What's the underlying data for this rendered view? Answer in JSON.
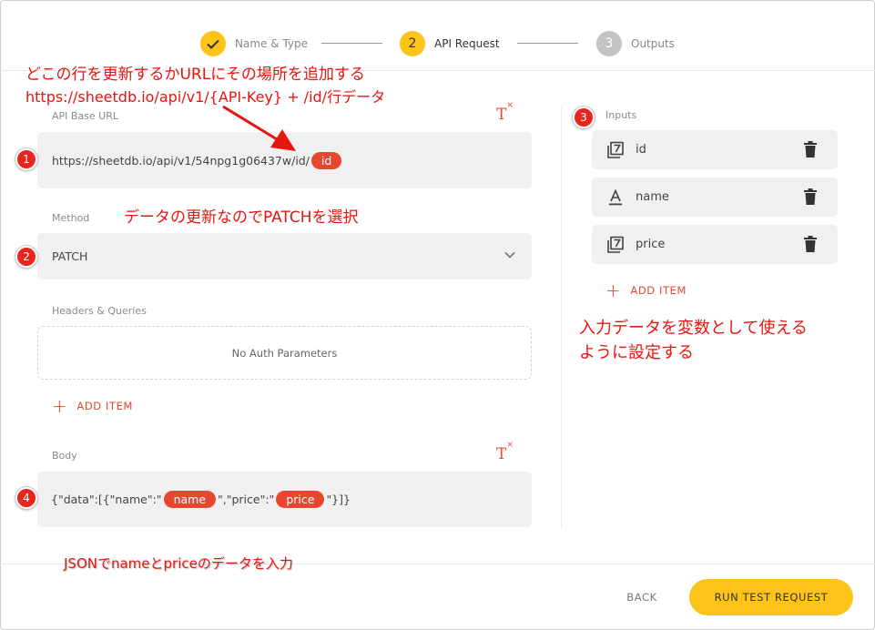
{
  "stepper": {
    "steps": [
      {
        "number": "✓",
        "label": "Name & Type",
        "state": "done"
      },
      {
        "number": "2",
        "label": "API Request",
        "state": "active"
      },
      {
        "number": "3",
        "label": "Outputs",
        "state": "pending"
      }
    ]
  },
  "form": {
    "api_base_url_label": "API Base URL",
    "api_base_url_value": "https://sheetdb.io/api/v1/54npg1g06437w/id/",
    "api_base_url_variable": "id",
    "method_label": "Method",
    "method_value": "PATCH",
    "headers_label": "Headers & Queries",
    "headers_empty": "No Auth Parameters",
    "add_item_label": "ADD ITEM",
    "body_label": "Body",
    "body_part1": "{\"data\":[{\"name\":\"",
    "body_var1": "name",
    "body_part2": "\",\"price\":\"",
    "body_var2": "price",
    "body_part3": "\"}]}"
  },
  "inputs": {
    "label": "Inputs",
    "items": [
      {
        "name": "id",
        "type": "number"
      },
      {
        "name": "name",
        "type": "text"
      },
      {
        "name": "price",
        "type": "number"
      }
    ],
    "add_item_label": "ADD ITEM"
  },
  "footer": {
    "back_label": "BACK",
    "run_label": "RUN TEST REQUEST"
  },
  "annotations": {
    "url_note_line1": "どこの行を更新するかURLにその場所を追加する",
    "url_note_line2": "https://sheetdb.io/api/v1/{API-Key} +  /id/行データ",
    "method_note": "データの更新なのでPATCHを選択",
    "inputs_note_line1": "入力データを変数として使える",
    "inputs_note_line2": "ように設定する",
    "body_note": "JSONでnameとpriceのデータを入力",
    "markers": [
      "1",
      "2",
      "3",
      "4"
    ]
  },
  "colors": {
    "accent": "#e8472f",
    "step_active": "#fcc419",
    "step_pending": "#c4c4c4",
    "annotation": "#e8150f"
  }
}
